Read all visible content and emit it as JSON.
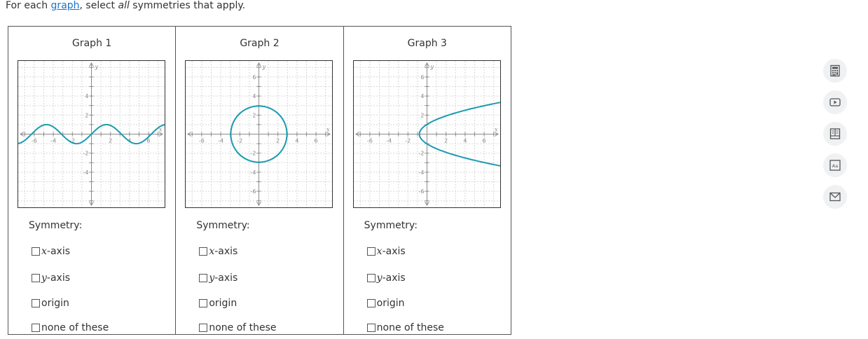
{
  "instructions": {
    "prefix": "For each ",
    "link": "graph",
    "middle": ", select ",
    "emph": "all",
    "suffix": " symmetries that apply."
  },
  "graphs": [
    {
      "title": "Graph 1",
      "symmetry_label": "Symmetry:",
      "options": [
        {
          "var": "x",
          "text": "-axis",
          "checked": false
        },
        {
          "var": "y",
          "text": "-axis",
          "checked": false
        },
        {
          "var": "",
          "text": "origin",
          "checked": false
        },
        {
          "var": "",
          "text": "none of these",
          "checked": false
        }
      ],
      "plot": {
        "xlabel": "x",
        "ylabel": "y",
        "x_ticks": [
          "-6",
          "-4",
          "-2",
          "2",
          "4",
          "6"
        ],
        "y_ticks": [
          "4",
          "2",
          "-2",
          "-4"
        ],
        "curve": "sine wave"
      }
    },
    {
      "title": "Graph 2",
      "symmetry_label": "Symmetry:",
      "options": [
        {
          "var": "x",
          "text": "-axis",
          "checked": false
        },
        {
          "var": "y",
          "text": "-axis",
          "checked": false
        },
        {
          "var": "",
          "text": "origin",
          "checked": false
        },
        {
          "var": "",
          "text": "none of these",
          "checked": false
        }
      ],
      "plot": {
        "xlabel": "x",
        "ylabel": "y",
        "x_ticks": [
          "-6",
          "-4",
          "-2",
          "2",
          "4",
          "6"
        ],
        "y_ticks": [
          "6",
          "4",
          "2",
          "-2",
          "-4",
          "-6"
        ],
        "curve": "circle"
      }
    },
    {
      "title": "Graph 3",
      "symmetry_label": "Symmetry:",
      "options": [
        {
          "var": "x",
          "text": "-axis",
          "checked": false
        },
        {
          "var": "y",
          "text": "-axis",
          "checked": false
        },
        {
          "var": "",
          "text": "origin",
          "checked": false
        },
        {
          "var": "",
          "text": "none of these",
          "checked": false
        }
      ],
      "plot": {
        "xlabel": "x",
        "ylabel": "y",
        "x_ticks": [
          "-6",
          "-4",
          "-2",
          "2",
          "4",
          "6"
        ],
        "y_ticks": [
          "6",
          "4",
          "2",
          "-2",
          "-4",
          "-6"
        ],
        "curve": "sideways parabola"
      }
    }
  ],
  "tools": [
    {
      "name": "calculator-icon"
    },
    {
      "name": "video-icon"
    },
    {
      "name": "ebook-icon"
    },
    {
      "name": "glossary-icon"
    },
    {
      "name": "email-icon"
    }
  ],
  "colors": {
    "curve": "#1a9cb0",
    "link": "#1a73c9",
    "grid": "#d7d7d7"
  }
}
